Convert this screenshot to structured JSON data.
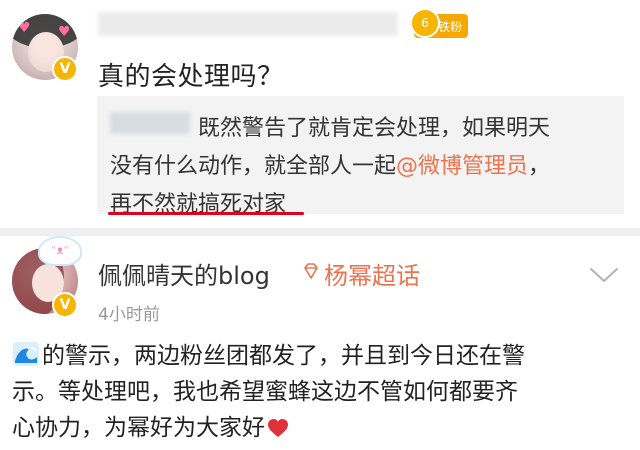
{
  "comment": {
    "fan_badge": "铁粉",
    "fan_level": "6",
    "text": "真的会处理吗？"
  },
  "reply": {
    "line1": "既然警告了就肯定会处理，如果明天",
    "line2_prefix": "没有什么动作，就全部人一起",
    "line2_mention": "@微博管理员",
    "line2_suffix": "，",
    "line3": "再不然就搞死对家"
  },
  "post": {
    "username": "佩佩晴天的blog",
    "super_topic": "杨幂超话",
    "time": "4小时前",
    "body_line1": "的警示，两边粉丝团都发了，并且到今日还在警",
    "body_line2": "示。等处理吧，我也希望蜜蜂这边不管如何都要齐",
    "body_line3": "心协力，为幂好为大家好"
  },
  "colors": {
    "accent": "#eb7350",
    "verified": "#f6b500",
    "underline": "#e2001a",
    "heart": "#e0303a"
  },
  "icons": [
    "verified-badge-icon",
    "crown-icon",
    "diamond-icon",
    "chevron-down-icon",
    "wave-emoji-icon",
    "heart-emoji-icon"
  ]
}
